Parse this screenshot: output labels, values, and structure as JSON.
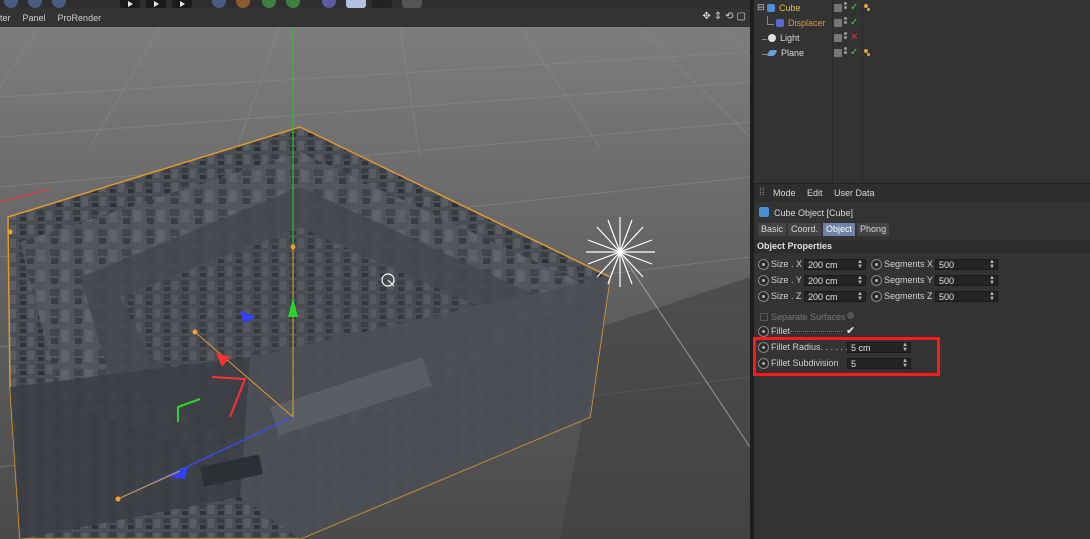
{
  "viewport_menu": [
    "lter",
    "Panel",
    "ProRender"
  ],
  "object_manager": {
    "objects": [
      {
        "name": "Cube",
        "icon": "cube-icon",
        "color": "#e8c040",
        "state": "check"
      },
      {
        "name": "Displacer",
        "icon": "displacer-icon",
        "color": "#d49a4a",
        "state": "check"
      },
      {
        "name": "Light",
        "icon": "light-icon",
        "color": "#d8d8d8",
        "state": "cross"
      },
      {
        "name": "Plane",
        "icon": "plane-icon",
        "color": "#d8d8d8",
        "state": "check"
      }
    ]
  },
  "attribute_manager": {
    "menu": [
      "Mode",
      "Edit",
      "User Data"
    ],
    "object_title": "Cube Object [Cube]",
    "tabs": [
      "Basic",
      "Coord.",
      "Object",
      "Phong"
    ],
    "active_tab": "Object",
    "section_title": "Object Properties",
    "size_x_label": "Size . X",
    "size_x_value": "200 cm",
    "size_y_label": "Size . Y",
    "size_y_value": "200 cm",
    "size_z_label": "Size . Z",
    "size_z_value": "200 cm",
    "seg_x_label": "Segments X",
    "seg_x_value": "500",
    "seg_y_label": "Segments Y",
    "seg_y_value": "500",
    "seg_z_label": "Segments Z",
    "seg_z_value": "500",
    "separate_surfaces_label": "Separate Surfaces",
    "fillet_label": "Fillet",
    "fillet_checked": "✔",
    "fillet_radius_label": "Fillet Radius. . . . . .",
    "fillet_radius_value": "5 cm",
    "fillet_subdivision_label": "Fillet Subdivision",
    "fillet_subdivision_value": "5"
  },
  "colors": {
    "highlight": "#ff1a1a",
    "active_tab": "#6b84a8",
    "selection_outline": "#e09a30"
  }
}
